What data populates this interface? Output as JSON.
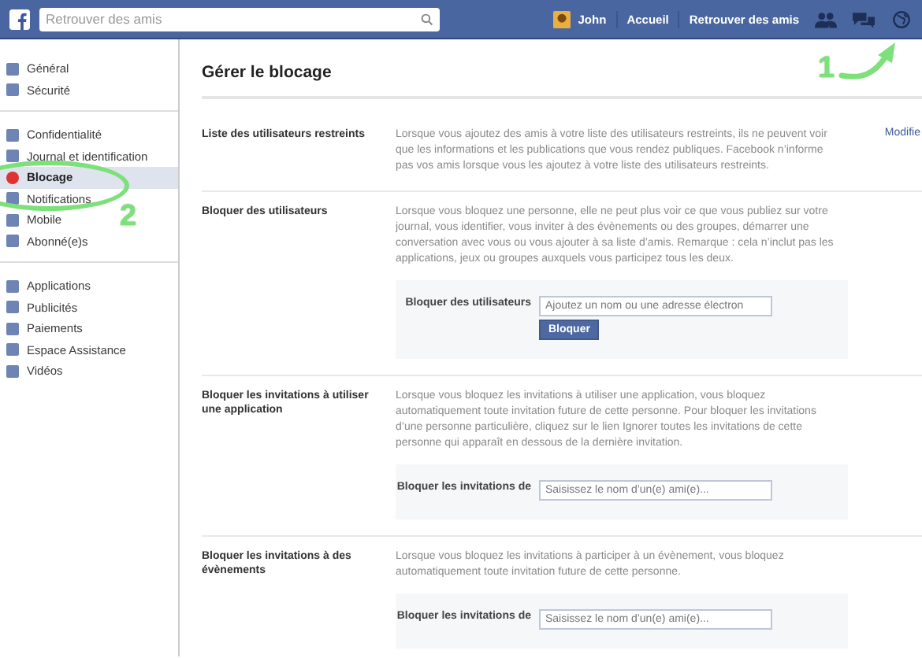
{
  "top_bar": {
    "search": {
      "placeholder": "Retrouver des amis"
    },
    "user": "John",
    "links": [
      "Accueil",
      "Retrouver des amis"
    ]
  },
  "sidebar": {
    "groups": [
      [
        {
          "label": "Général",
          "selected": false
        },
        {
          "label": "Sécurité",
          "selected": false
        }
      ],
      [
        {
          "label": "Confidentialité",
          "selected": false
        },
        {
          "label": "Journal et identification",
          "selected": false
        },
        {
          "label": "Blocage",
          "selected": true
        },
        {
          "label": "Notifications",
          "selected": false
        },
        {
          "label": "Mobile",
          "selected": false
        },
        {
          "label": "Abonné(e)s",
          "selected": false
        }
      ],
      [
        {
          "label": "Applications",
          "selected": false
        },
        {
          "label": "Publicités",
          "selected": false
        },
        {
          "label": "Paiements",
          "selected": false
        },
        {
          "label": "Espace Assistance",
          "selected": false
        },
        {
          "label": "Vidéos",
          "selected": false
        }
      ]
    ]
  },
  "page_title": "Gérer le blocage",
  "sections": [
    {
      "kind": "link",
      "title": "Liste des utilisateurs restreints",
      "description": "Lorsque vous ajoutez des amis à votre liste des utilisateurs restreints, ils ne peuvent voir que les informations et les publications que vous rendez publiques. Facebook n’informe pas vos amis lorsque vous les ajoutez à votre liste des utilisateurs restreints.",
      "action": "Modifie"
    },
    {
      "kind": "form",
      "title": "Bloquer des utilisateurs",
      "description": "Lorsque vous bloquez une personne, elle ne peut plus voir ce que vous publiez sur votre journal, vous identifier, vous inviter à des évènements ou des groupes, démarrer une conversation avec vous ou vous ajouter à sa liste d’amis. Remarque : cela n’inclut pas les applications, jeux ou groupes auxquels vous participez tous les deux.",
      "field_label": "Bloquer des utilisateurs",
      "placeholder": "Ajoutez un nom ou une adresse électron",
      "button": "Bloquer"
    },
    {
      "kind": "form",
      "title": "Bloquer les invitations à utiliser une application",
      "description": "Lorsque vous bloquez les invitations à utiliser une application, vous bloquez automatiquement toute invitation future de cette personne. Pour bloquer les invitations d’une personne particulière, cliquez sur le lien Ignorer toutes les invitations de cette personne qui apparaît en dessous de la dernière invitation.",
      "field_label": "Bloquer les invitations de",
      "placeholder": "Saisissez le nom d’un(e) ami(e)..."
    },
    {
      "kind": "form",
      "title": "Bloquer les invitations à des évènements",
      "description": "Lorsque vous bloquez les invitations à participer à un évènement, vous bloquez automatiquement toute invitation future de cette personne.",
      "field_label": "Bloquer les invitations de",
      "placeholder": "Saisissez le nom d’un(e) ami(e)..."
    }
  ],
  "annotations": [
    "1",
    "2"
  ]
}
